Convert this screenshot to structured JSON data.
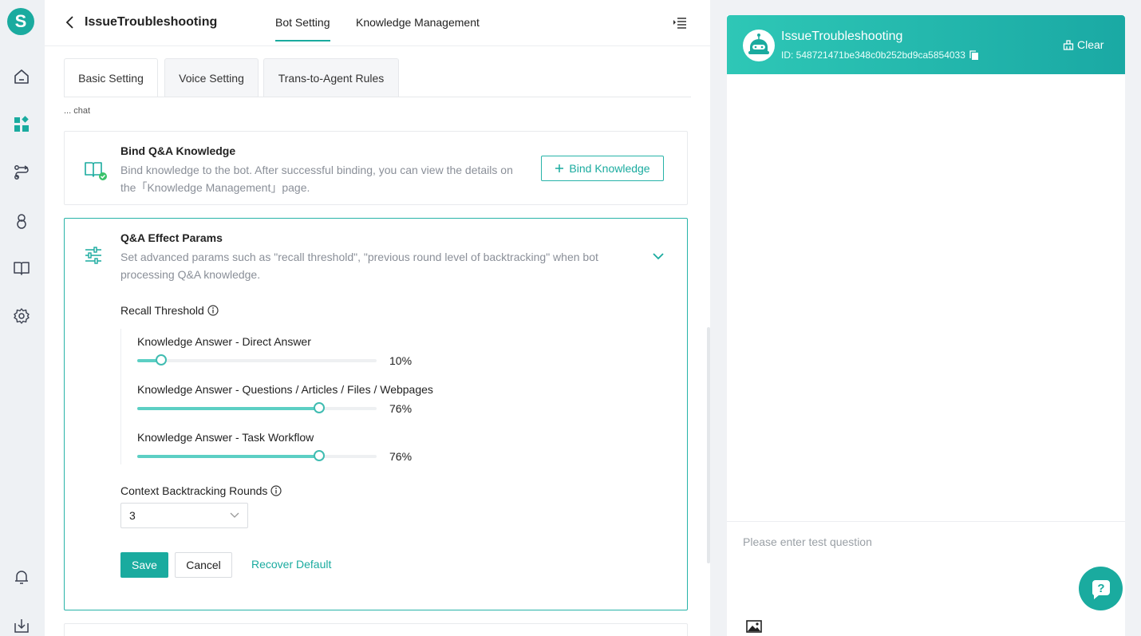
{
  "app": {
    "logo_letter": "S"
  },
  "header": {
    "title": "IssueTroubleshooting",
    "tabs": [
      {
        "label": "Bot Setting",
        "active": true
      },
      {
        "label": "Knowledge Management",
        "active": false
      }
    ]
  },
  "subtabs": [
    {
      "label": "Basic Setting",
      "active": true
    },
    {
      "label": "Voice Setting",
      "active": false
    },
    {
      "label": "Trans-to-Agent Rules",
      "active": false
    }
  ],
  "scrolled_section_label": "... chat",
  "bind_card": {
    "title": "Bind Q&A Knowledge",
    "description": "Bind knowledge to the bot. After successful binding, you can view the details on the「Knowledge Management」page.",
    "button_label": "Bind Knowledge"
  },
  "params_card": {
    "title": "Q&A Effect Params",
    "description": "Set advanced params such as \"recall threshold\", \"previous round level of backtracking\" when bot processing Q&A knowledge.",
    "recall_label": "Recall Threshold",
    "sliders": [
      {
        "label": "Knowledge Answer - Direct Answer",
        "value": 10,
        "display": "10%"
      },
      {
        "label": "Knowledge Answer - Questions / Articles / Files / Webpages",
        "value": 76,
        "display": "76%"
      },
      {
        "label": "Knowledge Answer - Task Workflow",
        "value": 76,
        "display": "76%"
      }
    ],
    "context_label": "Context Backtracking Rounds",
    "context_value": "3",
    "save_label": "Save",
    "cancel_label": "Cancel",
    "recover_label": "Recover Default"
  },
  "test_panel": {
    "bot_name": "IssueTroubleshooting",
    "bot_id": "ID: 548721471be348c0b252bd9ca5854033",
    "clear_label": "Clear",
    "input_placeholder": "Please enter test question"
  },
  "help": {
    "label": "?"
  },
  "colors": {
    "accent": "#1aab9f",
    "header_gradient_start": "#2ec7b6",
    "header_gradient_end": "#1aa9a4"
  }
}
